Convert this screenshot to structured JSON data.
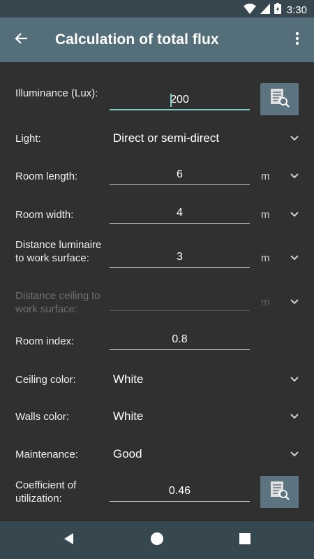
{
  "status": {
    "time": "3:30",
    "icons": [
      "wifi-icon",
      "signal-icon",
      "battery-icon"
    ]
  },
  "appbar": {
    "title": "Calculation of total flux",
    "back_icon": "arrow-left-icon",
    "menu_icon": "more-vert-icon"
  },
  "form": {
    "illuminance": {
      "label": "Illuminance (Lux):",
      "value": "200"
    },
    "light": {
      "label": "Light:",
      "value": "Direct or semi-direct"
    },
    "room_length": {
      "label": "Room length:",
      "value": "6",
      "unit": "m"
    },
    "room_width": {
      "label": "Room width:",
      "value": "4",
      "unit": "m"
    },
    "distance_luminaire": {
      "label": "Distance luminaire to work surface:",
      "value": "3",
      "unit": "m"
    },
    "distance_ceiling": {
      "label": "Distance ceiling to work surface:",
      "value": "",
      "unit": "m"
    },
    "room_index": {
      "label": "Room index:",
      "value": "0.8"
    },
    "ceiling_color": {
      "label": "Ceiling color:",
      "value": "White"
    },
    "walls_color": {
      "label": "Walls color:",
      "value": "White"
    },
    "maintenance": {
      "label": "Maintenance:",
      "value": "Good"
    },
    "coefficient": {
      "label": "Coefficient of utilization:",
      "value": "0.46"
    }
  },
  "colors": {
    "appbar": "#546e7a",
    "statusbar": "#37474f",
    "background": "#303030",
    "accent": "#80cbc4",
    "button": "#5b7480"
  },
  "navbar": {
    "icons": [
      "back-triangle-icon",
      "home-circle-icon",
      "recents-square-icon"
    ]
  }
}
